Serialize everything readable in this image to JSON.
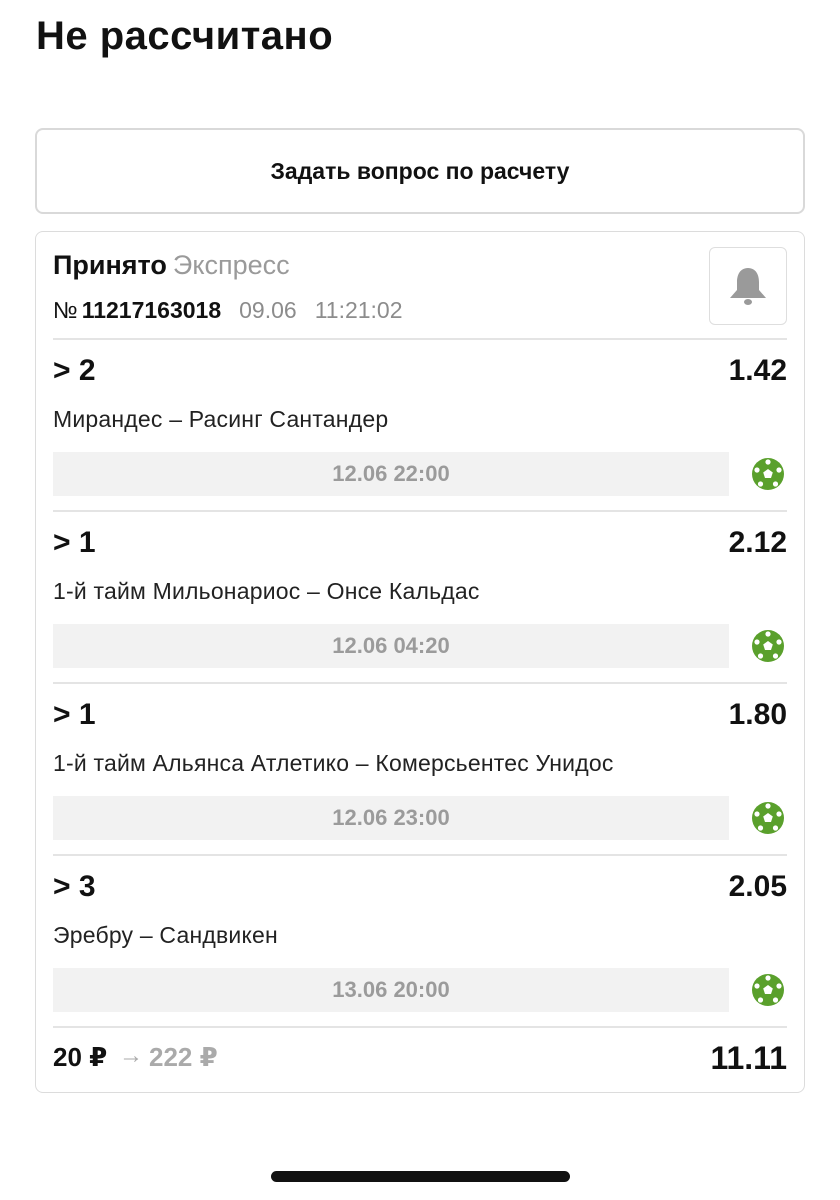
{
  "page": {
    "title": "Не рассчитано"
  },
  "actions": {
    "ask_question": "Задать вопрос по расчету"
  },
  "bet": {
    "status": "Принято",
    "type": "Экспресс",
    "number_prefix": "№",
    "number": "11217163018",
    "date": "09.06",
    "time": "11:21:02",
    "bell_icon": "bell-icon",
    "events": [
      {
        "outcome": "> 2",
        "odds": "1.42",
        "match": "Мирандес – Расинг Сантандер",
        "start": "12.06 22:00",
        "sport_icon": "soccer-ball-icon"
      },
      {
        "outcome": "> 1",
        "odds": "2.12",
        "match": "1-й тайм Мильонариос – Онсе Кальдас",
        "start": "12.06 04:20",
        "sport_icon": "soccer-ball-icon"
      },
      {
        "outcome": "> 1",
        "odds": "1.80",
        "match": "1-й тайм Альянса Атлетико – Комерсьентес Унидос",
        "start": "12.06 23:00",
        "sport_icon": "soccer-ball-icon"
      },
      {
        "outcome": "> 3",
        "odds": "2.05",
        "match": "Эребру – Сандвикен",
        "start": "13.06 20:00",
        "sport_icon": "soccer-ball-icon"
      }
    ],
    "stake": "20 ₽",
    "arrow": "→",
    "potential_win": "222 ₽",
    "total_odds": "11.11"
  },
  "colors": {
    "sport_icon": "#5aa02c",
    "muted": "#9a9a9a"
  }
}
